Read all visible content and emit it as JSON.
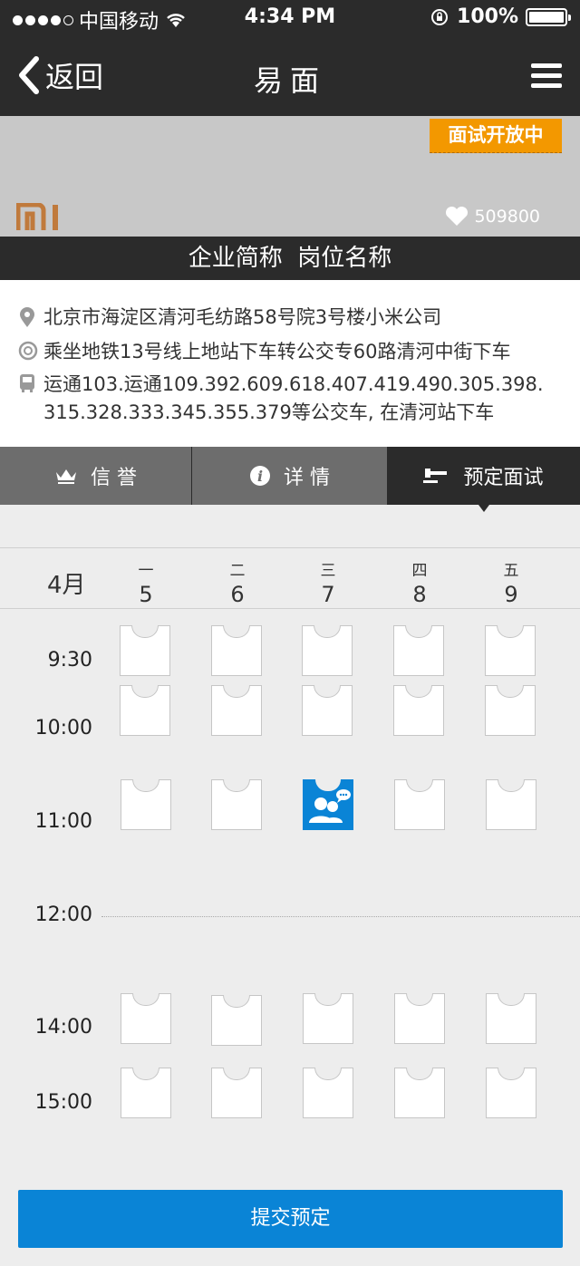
{
  "status_bar": {
    "carrier": "中国移动",
    "time": "4:34 PM",
    "battery": "100%",
    "signal_bars": 4,
    "battery_level": 1.0
  },
  "nav": {
    "back_label": "返回",
    "title": "易面"
  },
  "banner": {
    "ribbon": "面试开放中",
    "logo_text": "mi",
    "likes": "509800"
  },
  "company": {
    "title": "企业简称  岗位名称"
  },
  "info": {
    "address": "北京市海淀区清河毛纺路58号院3号楼小米公司",
    "subway": "乘坐地铁13号线上地站下车转公交专60路清河中街下车",
    "bus_line1": "运通103.运通109.392.609.618.407.419.490.305.398.",
    "bus_line2": "315.328.333.345.355.379等公交车, 在清河站下车"
  },
  "tabs": [
    {
      "label": "信 誉",
      "icon": "crown-icon"
    },
    {
      "label": "详 情",
      "icon": "info-icon"
    },
    {
      "label": "预定面试",
      "icon": "gavel-icon",
      "active": true
    }
  ],
  "calendar": {
    "month": "4月",
    "days": [
      {
        "weekday": "一",
        "date": "5"
      },
      {
        "weekday": "二",
        "date": "6"
      },
      {
        "weekday": "三",
        "date": "7"
      },
      {
        "weekday": "四",
        "date": "8"
      },
      {
        "weekday": "五",
        "date": "9"
      }
    ],
    "times": [
      "9:30",
      "10:00",
      "11:00",
      "12:00",
      "14:00",
      "15:00"
    ],
    "booked": {
      "time": "11:00",
      "day": "7"
    }
  },
  "submit_label": "提交预定",
  "colors": {
    "dark": "#2b2b2b",
    "accent_orange": "#f39800",
    "accent_blue": "#0a84d6",
    "tab_grey": "#6d6d6d"
  }
}
